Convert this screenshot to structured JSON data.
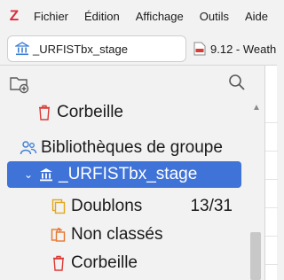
{
  "menubar": {
    "logo": "Z",
    "items": [
      "Fichier",
      "Édition",
      "Affichage",
      "Outils",
      "Aide"
    ]
  },
  "tabs": {
    "active_label": "_URFISTbx_stage",
    "other_label": "9.12 - Weath"
  },
  "tree": {
    "trash_top": "Corbeille",
    "group_header": "Bibliothèques de groupe",
    "selected_group": "_URFISTbx_stage",
    "duplicates": "Doublons",
    "duplicates_count": "13/31",
    "unfiled": "Non classés",
    "trash": "Corbeille"
  },
  "colors": {
    "accent": "#3f73d8",
    "icon_orange": "#e8762c",
    "icon_red": "#db3a34",
    "icon_yellow": "#e2a81d",
    "icon_blue": "#3d7fd3"
  }
}
